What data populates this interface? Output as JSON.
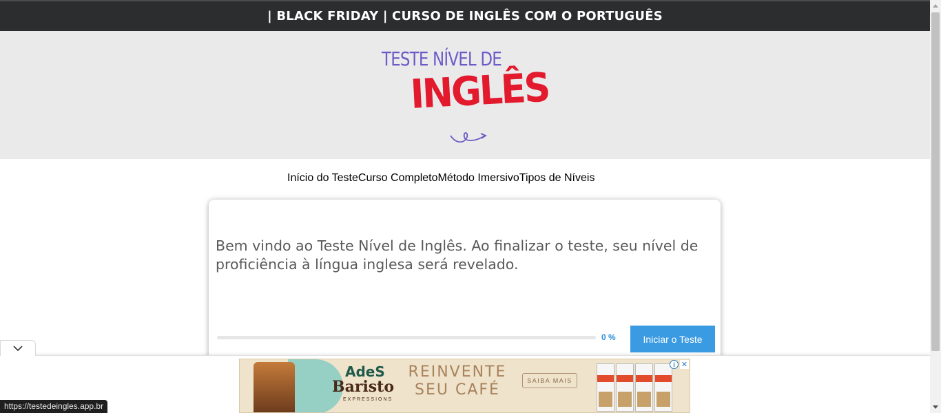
{
  "banner": {
    "text": "| BLACK FRIDAY | CURSO DE INGLÊS COM O PORTUGUÊS"
  },
  "logo": {
    "line1": "TESTE NÍVEL DE",
    "line2": "INGLÊS"
  },
  "nav": {
    "items": [
      {
        "label": "Início do Teste",
        "active": true
      },
      {
        "label": "Curso Completo",
        "active": false
      },
      {
        "label": "Método Imersivo",
        "active": false
      },
      {
        "label": "Tipos de Níveis",
        "active": false
      }
    ]
  },
  "card": {
    "intro": "Bem vindo ao Teste Nível de Inglês. Ao finalizar o teste, seu nível de proficiência à língua inglesa será revelado.",
    "progress_percent": 0,
    "progress_label": "0 %",
    "start_button": "Iniciar o Teste"
  },
  "ad": {
    "brand_top": "AdeS",
    "brand_main": "Baristo",
    "brand_sub": "EXPRESSIONS",
    "headline": "REINVENTE SEU CAFÉ",
    "cta": "SAIBA MAIS",
    "info_icon": "ⓘ",
    "close_icon": "✕"
  },
  "status": {
    "url": "https://testedeingles.app.br"
  },
  "colors": {
    "accent": "#3b9be2",
    "nav_active": "#3b2bb5",
    "logo_red": "#e3192d",
    "logo_purple": "#6b5bc8",
    "topbar": "#2b2d2f"
  }
}
